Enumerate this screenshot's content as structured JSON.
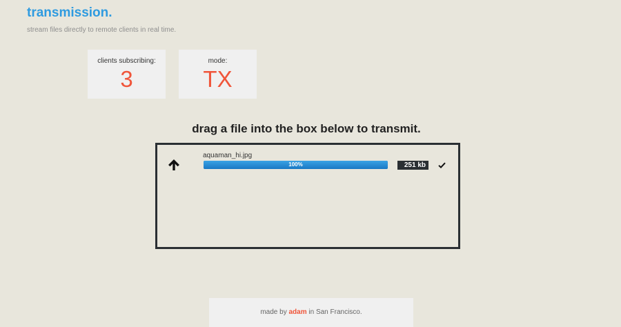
{
  "header": {
    "title": "transmission.",
    "subtitle": "stream files directly to remote clients in real time."
  },
  "stats": {
    "clients_label": "clients subscribing:",
    "clients_value": "3",
    "mode_label": "mode:",
    "mode_value": "TX"
  },
  "dropzone": {
    "instruction": "drag a file into the box below to transmit.",
    "files": [
      {
        "name": "aquaman_hi.jpg",
        "progress_text": "100%",
        "progress_value": 1.0,
        "size": "251 kb",
        "status_icon": "check-icon",
        "direction_icon": "arrow-up-icon"
      }
    ]
  },
  "footer": {
    "prefix": "made by ",
    "author": "adam",
    "suffix": " in San Francisco."
  },
  "colors": {
    "accent_blue": "#2f9be0",
    "accent_orange": "#f0553a",
    "background": "#e8e6dc",
    "dark": "#2a2f33"
  }
}
